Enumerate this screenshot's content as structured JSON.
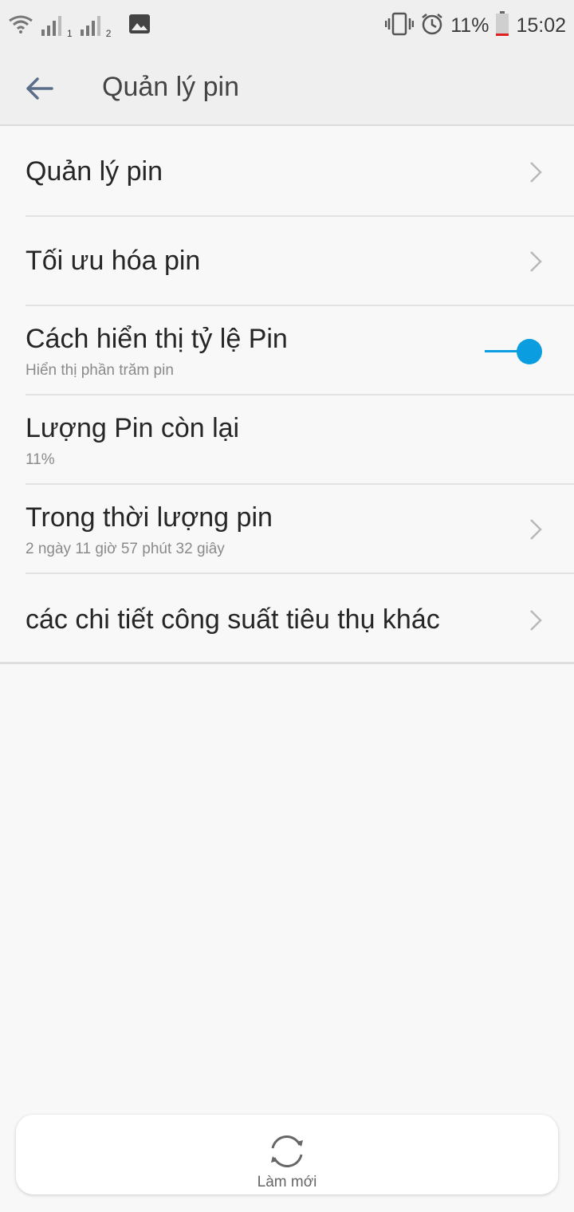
{
  "status_bar": {
    "sim1_label": "1",
    "sim2_label": "2",
    "battery_text": "11%",
    "time": "15:02",
    "battery_level": 0.11,
    "battery_low_color": "#e02020"
  },
  "header": {
    "title": "Quản lý pin"
  },
  "rows": [
    {
      "title": "Quản lý pin",
      "subtitle": "",
      "control": "chevron"
    },
    {
      "title": "Tối ưu hóa pin",
      "subtitle": "",
      "control": "chevron"
    },
    {
      "title": "Cách hiển thị tỷ lệ Pin",
      "subtitle": "Hiển thị phần trăm pin",
      "control": "toggle",
      "toggle_on": true
    },
    {
      "title": "Lượng Pin còn lại",
      "subtitle": "11%",
      "control": "none"
    },
    {
      "title": "Trong thời lượng pin",
      "subtitle": "2 ngày 11 giờ 57 phút 32 giây",
      "control": "chevron"
    },
    {
      "title": "các chi tiết công suất tiêu thụ khác",
      "subtitle": "",
      "control": "chevron"
    }
  ],
  "bottom": {
    "refresh_label": "Làm mới"
  },
  "colors": {
    "accent": "#0a9ee0",
    "text_primary": "#262626",
    "text_secondary": "#8a8a8a",
    "chevron": "#b9b9b9"
  }
}
